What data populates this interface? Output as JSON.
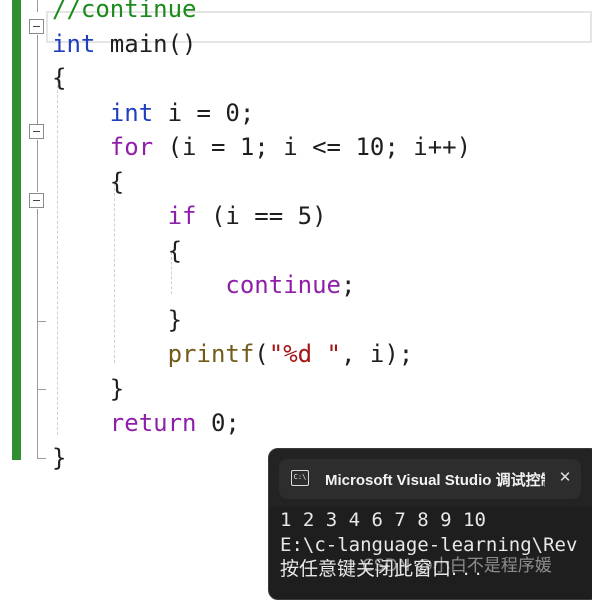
{
  "editor": {
    "lines": [
      {
        "segments": [
          {
            "cls": "comment",
            "text": "//continue"
          }
        ]
      },
      {
        "segments": [
          {
            "cls": "kw",
            "text": "int"
          },
          {
            "cls": "txt",
            "text": " main()"
          }
        ]
      },
      {
        "segments": [
          {
            "cls": "txt",
            "text": "{"
          }
        ]
      },
      {
        "segments": [
          {
            "cls": "txt",
            "text": "    "
          },
          {
            "cls": "kw",
            "text": "int"
          },
          {
            "cls": "txt",
            "text": " i = 0;"
          }
        ]
      },
      {
        "segments": [
          {
            "cls": "txt",
            "text": "    "
          },
          {
            "cls": "ctl",
            "text": "for"
          },
          {
            "cls": "txt",
            "text": " (i = 1; i <= 10; i++)"
          }
        ]
      },
      {
        "segments": [
          {
            "cls": "txt",
            "text": "    {"
          }
        ]
      },
      {
        "segments": [
          {
            "cls": "txt",
            "text": "        "
          },
          {
            "cls": "ctl",
            "text": "if"
          },
          {
            "cls": "txt",
            "text": " (i == 5)"
          }
        ]
      },
      {
        "segments": [
          {
            "cls": "txt",
            "text": "        {"
          }
        ]
      },
      {
        "segments": [
          {
            "cls": "txt",
            "text": "            "
          },
          {
            "cls": "ctl",
            "text": "continue"
          },
          {
            "cls": "txt",
            "text": ";"
          }
        ]
      },
      {
        "segments": [
          {
            "cls": "txt",
            "text": "        }"
          }
        ]
      },
      {
        "segments": [
          {
            "cls": "txt",
            "text": "        "
          },
          {
            "cls": "fn",
            "text": "printf"
          },
          {
            "cls": "txt",
            "text": "("
          },
          {
            "cls": "str",
            "text": "\"%d \""
          },
          {
            "cls": "txt",
            "text": ", i);"
          }
        ]
      },
      {
        "segments": [
          {
            "cls": "txt",
            "text": "    }"
          }
        ]
      },
      {
        "segments": [
          {
            "cls": "txt",
            "text": "    "
          },
          {
            "cls": "ctl",
            "text": "return"
          },
          {
            "cls": "txt",
            "text": " 0;"
          }
        ]
      },
      {
        "segments": [
          {
            "cls": "txt",
            "text": "}"
          }
        ]
      }
    ]
  },
  "console": {
    "title": "Microsoft Visual Studio 调试控制台",
    "icon_label": "C:\\",
    "close_glyph": "✕",
    "output": [
      "1 2 3 4 6 7 8 9 10",
      "E:\\c-language-learning\\Rev",
      "按任意键关闭此窗口. . ."
    ]
  },
  "watermark": "CSDN @小白不是程序媛",
  "colors": {
    "keyword": "#1f3fbf",
    "control": "#8f1fa8",
    "function": "#735c1a",
    "string": "#a31515",
    "comment": "#1a8a1a",
    "change_bar": "#2f8f2f",
    "console_bg": "#1e1e1e"
  },
  "icons": [
    "fold-collapse-icon",
    "console-app-icon",
    "close-icon"
  ]
}
